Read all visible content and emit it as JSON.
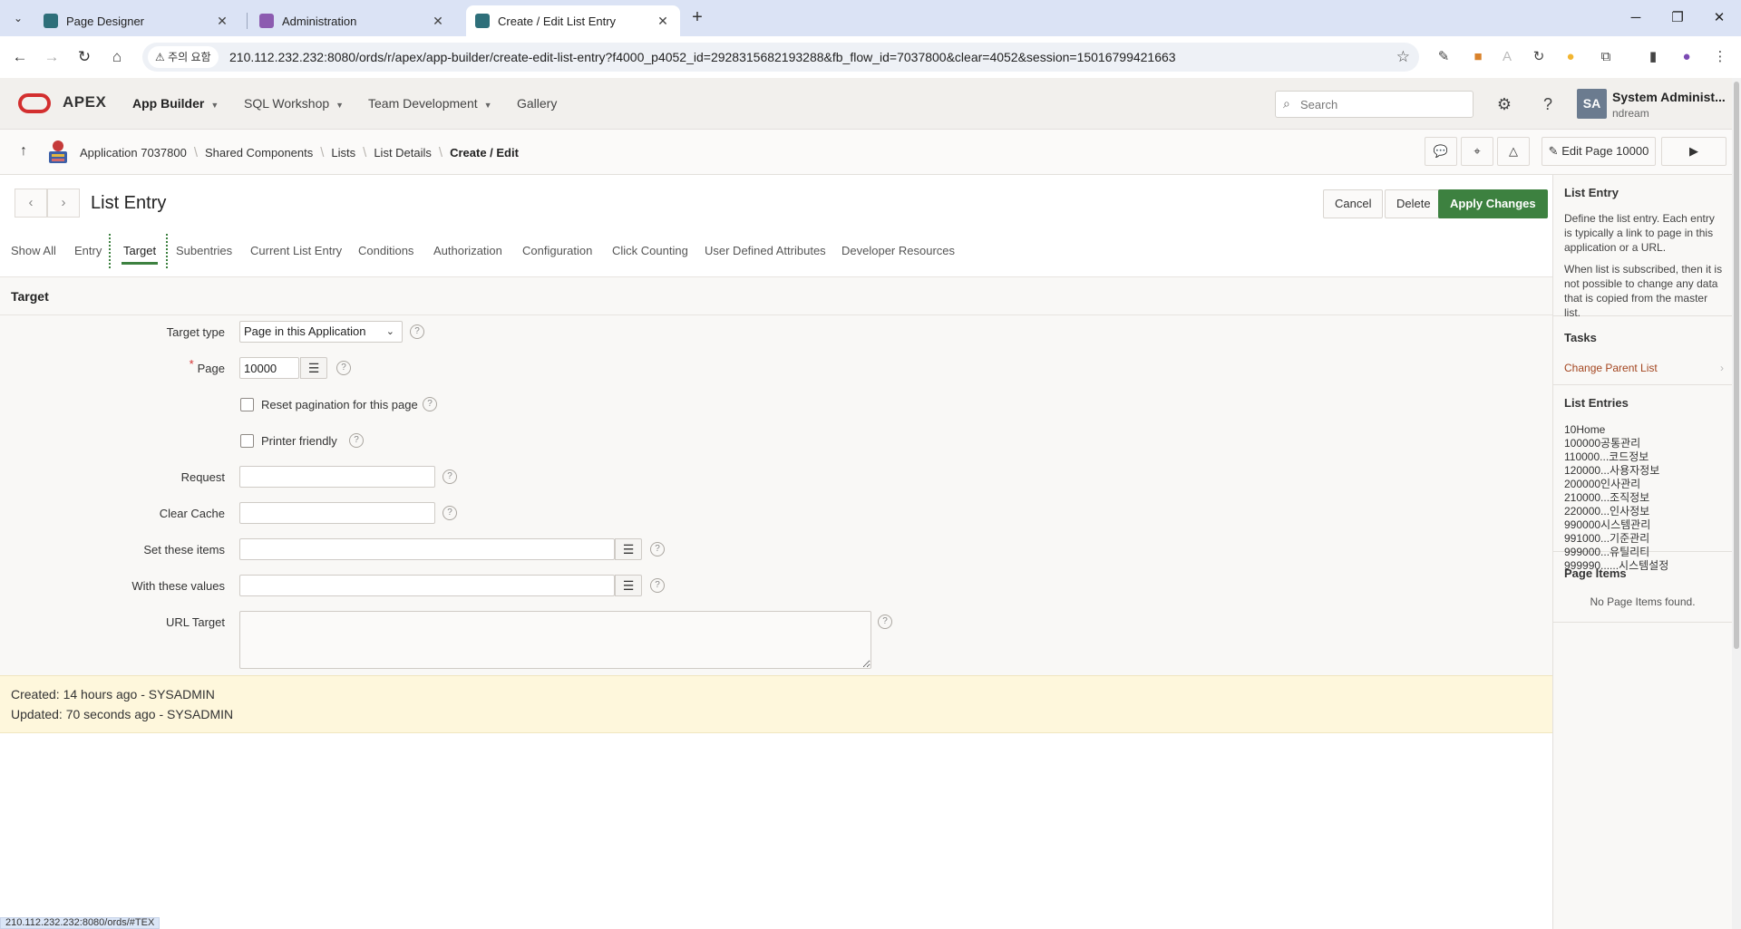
{
  "browser": {
    "tabs": [
      {
        "title": "Page Designer",
        "active": false
      },
      {
        "title": "Administration",
        "active": false
      },
      {
        "title": "Create / Edit List Entry",
        "active": true
      }
    ],
    "security_label": "주의 요함",
    "url": "210.112.232.232:8080/ords/r/apex/app-builder/create-edit-list-entry?f4000_p4052_id=2928315682193288&fb_flow_id=7037800&clear=4052&session=15016799421663",
    "status_url": "210.112.232.232:8080/ords/#TEX"
  },
  "header": {
    "logo_text": "APEX",
    "nav": [
      "App Builder",
      "SQL Workshop",
      "Team Development",
      "Gallery"
    ],
    "search_placeholder": "Search",
    "avatar_initials": "SA",
    "user_name": "System Administ...",
    "user_id": "ndream"
  },
  "breadcrumb": {
    "items": [
      "Application 7037800",
      "Shared Components",
      "Lists",
      "List Details",
      "Create / Edit"
    ],
    "edit_page_label": "Edit Page 10000"
  },
  "page": {
    "title": "List Entry",
    "buttons": {
      "cancel": "Cancel",
      "delete": "Delete",
      "apply": "Apply Changes"
    },
    "tabs": [
      "Show All",
      "Entry",
      "Target",
      "Subentries",
      "Current List Entry",
      "Conditions",
      "Authorization",
      "Configuration",
      "Click Counting",
      "User Defined Attributes",
      "Developer Resources"
    ],
    "active_tab": "Target"
  },
  "target_region": {
    "title": "Target",
    "target_type_label": "Target type",
    "target_type_value": "Page in this Application",
    "page_label": "Page",
    "page_value": "10000",
    "reset_pagination_label": "Reset pagination for this page",
    "reset_pagination_checked": false,
    "printer_friendly_label": "Printer friendly",
    "printer_friendly_checked": false,
    "request_label": "Request",
    "request_value": "",
    "clear_cache_label": "Clear Cache",
    "clear_cache_value": "",
    "set_items_label": "Set these items",
    "set_items_value": "",
    "with_values_label": "With these values",
    "with_values_value": "",
    "url_target_label": "URL Target",
    "url_target_value": ""
  },
  "audit": {
    "created": "Created: 14 hours ago - SYSADMIN",
    "updated": "Updated: 70 seconds ago - SYSADMIN"
  },
  "sidebar": {
    "help_title": "List Entry",
    "help_p1": "Define the list entry. Each entry is typically a link to page in this application or a URL.",
    "help_p2": "When list is subscribed, then it is not possible to change any data that is copied from the master list.",
    "tasks_title": "Tasks",
    "tasks": [
      "Change Parent List"
    ],
    "list_entries_title": "List Entries",
    "list_entries": [
      "10Home",
      "100000공통관리",
      "110000...코드정보",
      "120000...사용자정보",
      "200000인사관리",
      "210000...조직정보",
      "220000...인사정보",
      "990000시스템관리",
      "991000...기준관리",
      "999000...유틸리티",
      "999990......시스템설정"
    ],
    "page_items_title": "Page Items",
    "page_items_empty": "No Page Items found."
  },
  "colors": {
    "primary_button": "#3d8140",
    "logo_red": "#d32f2f",
    "task_link": "#a3451f",
    "audit_bg": "#fef7dc"
  }
}
